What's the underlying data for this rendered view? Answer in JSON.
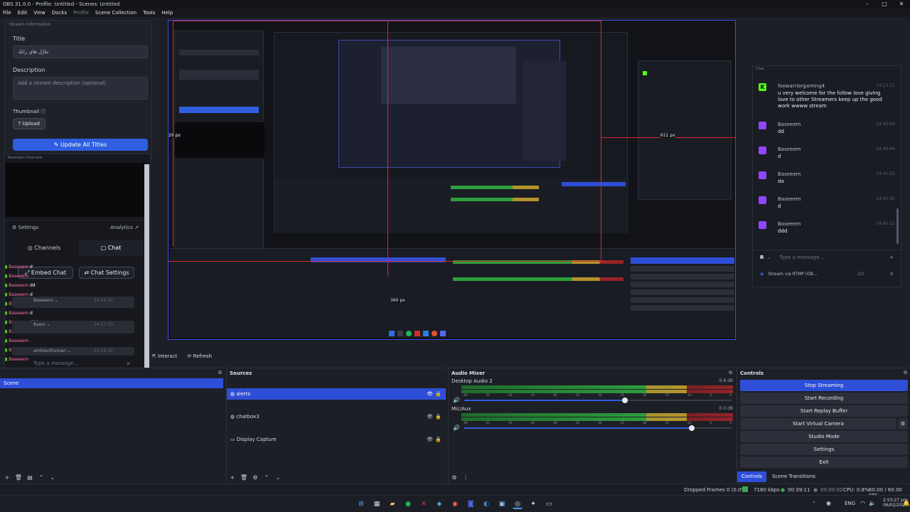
{
  "window": {
    "title": "OBS 31.0.0 - Profile: Untitled - Scenes: Untitled"
  },
  "menu": [
    "File",
    "Edit",
    "View",
    "Docks",
    "Profile",
    "Scene Collection",
    "Tools",
    "Help"
  ],
  "stream_info": {
    "dock_title": "Stream Information",
    "title_label": "Title",
    "title_value": "مارْل هاي راتك",
    "description_label": "Description",
    "description_placeholder": "Add a stream description (optional)",
    "thumbnail_label": "Thumbnail",
    "upload_label": "Upload",
    "update_label": "Update All Titles"
  },
  "restream": {
    "dock_title": "Restream Channels",
    "settings_label": "Settings",
    "analytics_label": "Analytics",
    "channels_tab": "Channels",
    "chat_tab": "Chat",
    "embed_chat_label": "Embed Chat",
    "chat_settings_label": "Chat Settings",
    "ghost_user": "Baseeem",
    "ghost_lines": [
      "d",
      "dd",
      "d",
      "da",
      "d",
      "ddd",
      "d"
    ],
    "ghost_msgs": [
      {
        "user": "Baseeem",
        "time": "14:16:52",
        "text": "da"
      },
      {
        "user": "Basm",
        "time": "14:17:03",
        "text": "dd"
      },
      {
        "user": "ambienthuman",
        "time": "14:18:02",
        "text": ""
      }
    ],
    "message_placeholder": "Type a message..."
  },
  "preview": {
    "dim_29": "29 px",
    "dim_611": "611 px",
    "dim_360": "360 px"
  },
  "buttons": {
    "interact": "Interact",
    "refresh": "Refresh"
  },
  "chat": {
    "dock_title": "Chat",
    "messages": [
      {
        "platform": "kick",
        "user": "foxwarriorgaming4",
        "time": "14:13:11",
        "text": "u very welcome for the follow love giving love to other Streamers keep up the good work wwww stream"
      },
      {
        "platform": "twitch",
        "user": "Baseeem",
        "time": "14:40:44",
        "text": "dd"
      },
      {
        "platform": "twitch",
        "user": "Baseeem",
        "time": "14:40:44",
        "text": "d"
      },
      {
        "platform": "twitch",
        "user": "Baseeem",
        "time": "14:41:15",
        "text": "da"
      },
      {
        "platform": "twitch",
        "user": "Baseeem",
        "time": "14:41:42",
        "text": "d"
      },
      {
        "platform": "twitch",
        "user": "Baseeem",
        "time": "14:42:12",
        "text": "ddd"
      }
    ],
    "input_placeholder": "Type a message...",
    "stream_label": "Stream via RTMP (OB...",
    "count": "2/2"
  },
  "scenes": {
    "items": [
      "Scene"
    ]
  },
  "sources": {
    "title": "Sources",
    "items": [
      {
        "name": "alerts",
        "selected": true
      },
      {
        "name": "chatbox3",
        "selected": false
      },
      {
        "name": "Display Capture",
        "selected": false
      }
    ]
  },
  "mixer": {
    "title": "Audio Mixer",
    "channels": [
      {
        "name": "Desktop Audio 2",
        "db": "-9.8 dB",
        "level": 0.6
      },
      {
        "name": "Mic/Aux",
        "db": "0.0 dB",
        "level": 0.85
      }
    ],
    "ticks": [
      "-60",
      "-55",
      "-50",
      "-45",
      "-40",
      "-35",
      "-30",
      "-25",
      "-20",
      "-15",
      "-10",
      "-5",
      "0"
    ]
  },
  "controls": {
    "title": "Controls",
    "buttons": [
      "Stop Streaming",
      "Start Recording",
      "Start Replay Buffer",
      "Start Virtual Camera",
      "Studio Mode",
      "Settings",
      "Exit"
    ],
    "tabs": [
      "Controls",
      "Scene Transitions"
    ]
  },
  "status": {
    "dropped": "Dropped Frames 0 (0.0%)",
    "bitrate": "7180 kbps",
    "stream_time": "00:39:11",
    "rec_time": "00:00:00",
    "cpu": "CPU: 0.8%",
    "fps": "60.00 / 60.00 FPS"
  },
  "taskbar": {
    "lang": "ENG",
    "time": "2:53:27 pm",
    "date": "06/02/2026"
  },
  "colors": {
    "accent": "#2f5ee0",
    "kick": "#53fc18",
    "twitch": "#9146ff",
    "red_guide": "#d12c2c"
  }
}
